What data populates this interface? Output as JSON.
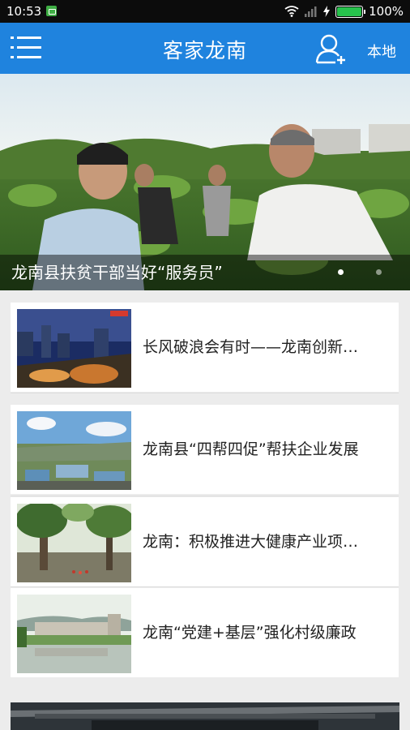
{
  "status_bar": {
    "time": "10:53",
    "battery_percent": "100%"
  },
  "app_bar": {
    "title": "客家龙南",
    "local_label": "本地"
  },
  "banner": {
    "caption": "龙南县扶贫干部当好“服务员”",
    "slide_count": 2,
    "active_index": 0
  },
  "news": [
    {
      "title": "长风破浪会有时——龙南创新…",
      "thumb": "city-night-icon"
    },
    {
      "title": "龙南县“四帮四促”帮扶企业发展",
      "thumb": "industrial-park-icon"
    },
    {
      "title": "龙南：积极推进大健康产业项…",
      "thumb": "forest-icon"
    },
    {
      "title": "龙南“党建+基层”强化村级廉政",
      "thumb": "village-pond-icon"
    }
  ],
  "colors": {
    "accent": "#1f83de",
    "status_bar": "#0c0c0c",
    "background": "#ececec"
  }
}
